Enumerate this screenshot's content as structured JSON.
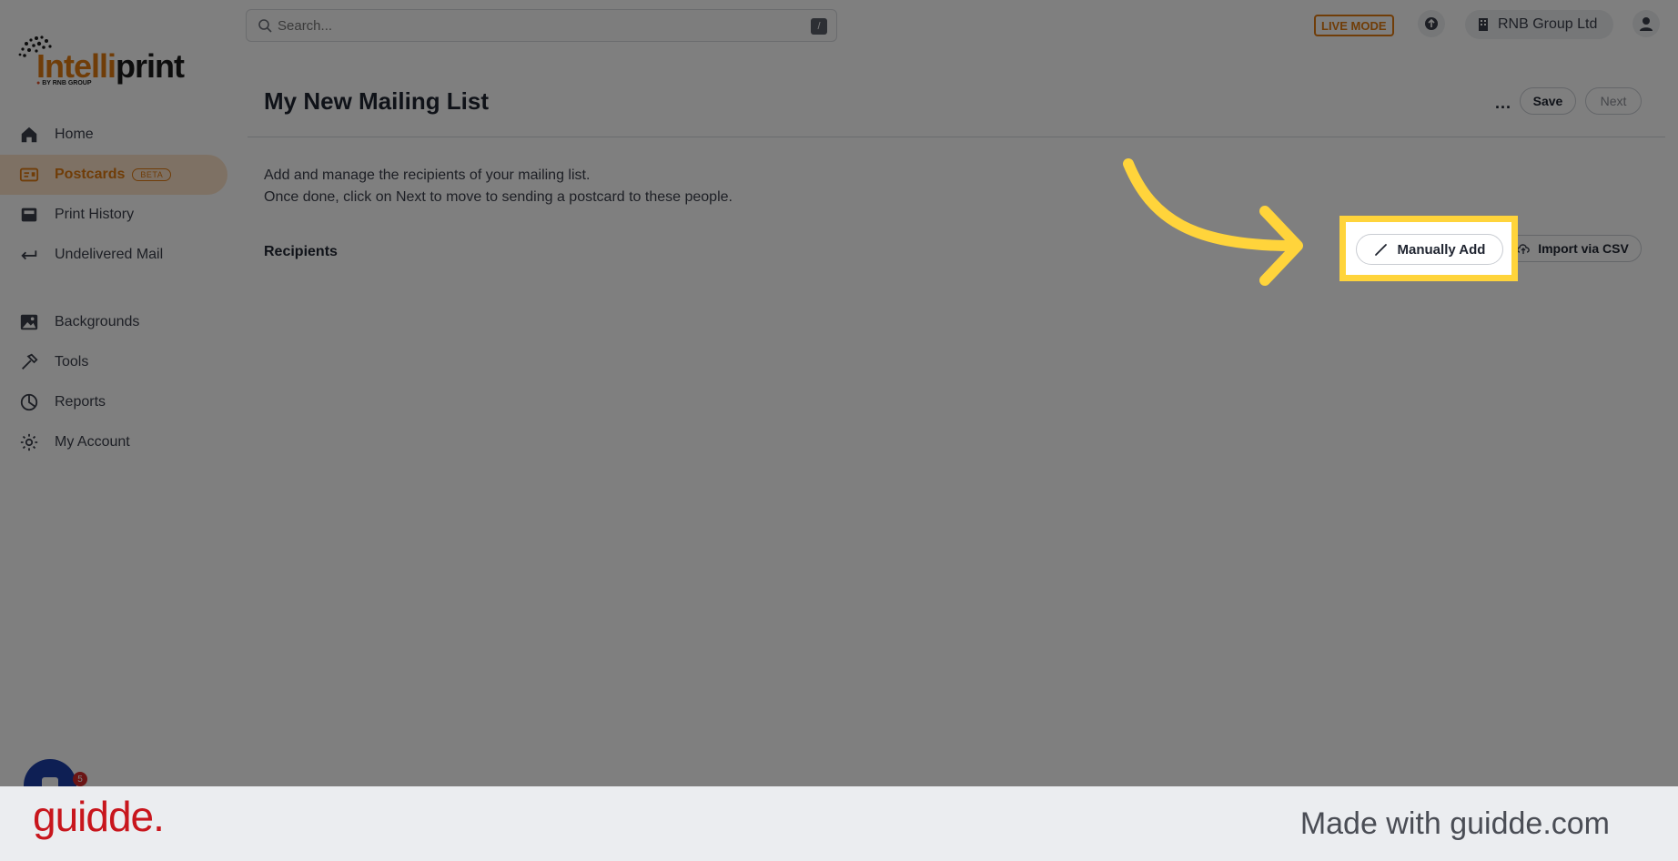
{
  "search": {
    "placeholder": "Search...",
    "shortcut": "/"
  },
  "topbar": {
    "live_mode": "LIVE MODE",
    "organization": "RNB Group Ltd"
  },
  "brand": {
    "logo_part1": "Intelli",
    "logo_part2": "print",
    "logo_sub": "BY RNB GROUP"
  },
  "sidebar": {
    "items": [
      {
        "label": "Home",
        "icon": "home-icon"
      },
      {
        "label": "Postcards",
        "icon": "postcard-icon",
        "badge": "BETA",
        "active": true
      },
      {
        "label": "Print History",
        "icon": "archive-icon"
      },
      {
        "label": "Undelivered Mail",
        "icon": "return-arrow-icon"
      },
      {
        "label": "Backgrounds",
        "icon": "image-icon"
      },
      {
        "label": "Tools",
        "icon": "hammer-icon"
      },
      {
        "label": "Reports",
        "icon": "pie-chart-icon"
      },
      {
        "label": "My Account",
        "icon": "gear-icon"
      }
    ]
  },
  "main": {
    "title": "My New Mailing List",
    "more": "...",
    "save_label": "Save",
    "next_label": "Next",
    "description_line1": "Add and manage the recipients of your mailing list.",
    "description_line2": "Once done, click on Next to move to sending a postcard to these people.",
    "recipients_label": "Recipients",
    "manually_add_label": "Manually Add",
    "import_csv_label": "Import via CSV"
  },
  "chat": {
    "badge_count": "5"
  },
  "footer": {
    "brand": "guidde.",
    "made_with": "Made with guidde.com"
  },
  "colors": {
    "accent": "#e07a10",
    "highlight": "#ffd43b",
    "brand_red": "#c8161d"
  }
}
